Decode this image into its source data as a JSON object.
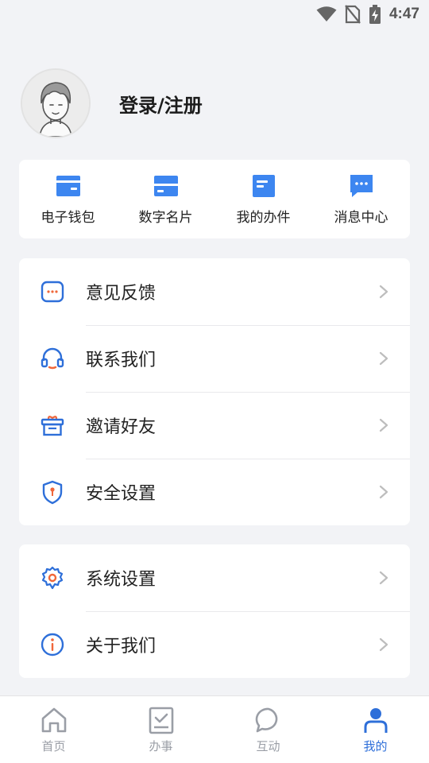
{
  "status_bar": {
    "time": "4:47",
    "icons": [
      "wifi-icon",
      "no-sim-icon",
      "battery-charging-icon"
    ]
  },
  "profile": {
    "login_label": "登录/注册",
    "avatar_icon": "avatar-cartoon-icon"
  },
  "quick_actions": [
    {
      "label": "电子钱包",
      "icon": "wallet-icon"
    },
    {
      "label": "数字名片",
      "icon": "business-card-icon"
    },
    {
      "label": "我的办件",
      "icon": "document-icon"
    },
    {
      "label": "消息中心",
      "icon": "message-icon"
    }
  ],
  "menu_group_1": [
    {
      "label": "意见反馈",
      "icon": "feedback-icon"
    },
    {
      "label": "联系我们",
      "icon": "headset-icon"
    },
    {
      "label": "邀请好友",
      "icon": "gift-icon"
    },
    {
      "label": "安全设置",
      "icon": "shield-icon"
    }
  ],
  "menu_group_2": [
    {
      "label": "系统设置",
      "icon": "gear-icon"
    },
    {
      "label": "关于我们",
      "icon": "info-icon"
    }
  ],
  "bottom_nav": [
    {
      "label": "首页",
      "icon": "home-icon",
      "active": false
    },
    {
      "label": "办事",
      "icon": "checklist-icon",
      "active": false
    },
    {
      "label": "互动",
      "icon": "chat-bubble-icon",
      "active": false
    },
    {
      "label": "我的",
      "icon": "user-icon",
      "active": true
    }
  ],
  "colors": {
    "accent": "#2e6fd9",
    "icon_blue": "#3d86f0",
    "icon_orange": "#f0673a",
    "nav_inactive": "#9a9ea6",
    "background": "#f2f3f6"
  }
}
